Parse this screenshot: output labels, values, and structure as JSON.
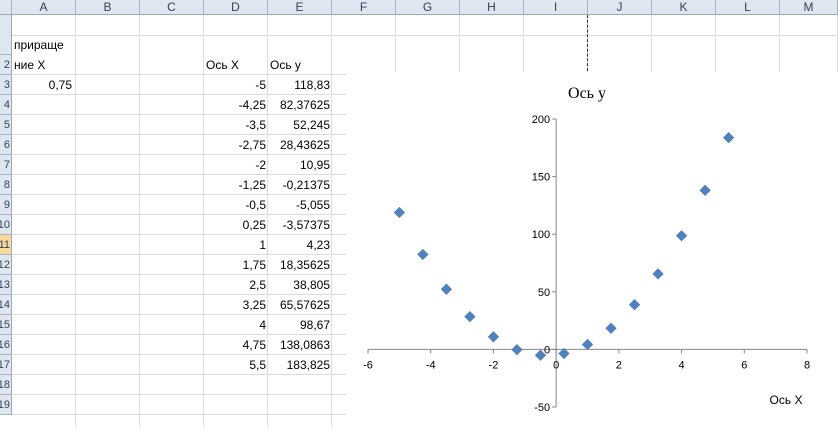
{
  "columns": [
    "A",
    "B",
    "C",
    "D",
    "E",
    "F",
    "G",
    "H",
    "I",
    "J",
    "K",
    "L",
    "M"
  ],
  "rows": [
    "2",
    "3",
    "4",
    "5",
    "6",
    "7",
    "8",
    "9",
    "10",
    "11",
    "12",
    "13",
    "14",
    "15",
    "16",
    "17",
    "18",
    "19"
  ],
  "selected_row": "11",
  "cells": {
    "a1_line1": "прираще",
    "a1_line2": "ние X",
    "a3": "0,75",
    "d2": "Ось X",
    "e2": "Ось y"
  },
  "table": {
    "x": [
      "-5",
      "-4,25",
      "-3,5",
      "-2,75",
      "-2",
      "-1,25",
      "-0,5",
      "0,25",
      "1",
      "1,75",
      "2,5",
      "3,25",
      "4",
      "4,75",
      "5,5"
    ],
    "y": [
      "118,83",
      "82,37625",
      "52,245",
      "28,43625",
      "10,95",
      "-0,21375",
      "-5,055",
      "-3,57375",
      "4,23",
      "18,35625",
      "38,805",
      "65,57625",
      "98,67",
      "138,0863",
      "183,825"
    ]
  },
  "chart_data": {
    "type": "scatter",
    "title": "Ось y",
    "xlabel": "Ось X",
    "ylabel": "",
    "xlim": [
      -6,
      8
    ],
    "ylim": [
      -50,
      200
    ],
    "xticks": [
      -6,
      -4,
      -2,
      0,
      2,
      4,
      6,
      8
    ],
    "yticks": [
      -50,
      0,
      50,
      100,
      150,
      200
    ],
    "marker_color": "#4f81bd",
    "x": [
      -5,
      -4.25,
      -3.5,
      -2.75,
      -2,
      -1.25,
      -0.5,
      0.25,
      1,
      1.75,
      2.5,
      3.25,
      4,
      4.75,
      5.5
    ],
    "y": [
      118.83,
      82.37625,
      52.245,
      28.43625,
      10.95,
      -0.21375,
      -5.055,
      -3.57375,
      4.23,
      18.35625,
      38.805,
      65.57625,
      98.67,
      138.0863,
      183.825
    ]
  }
}
